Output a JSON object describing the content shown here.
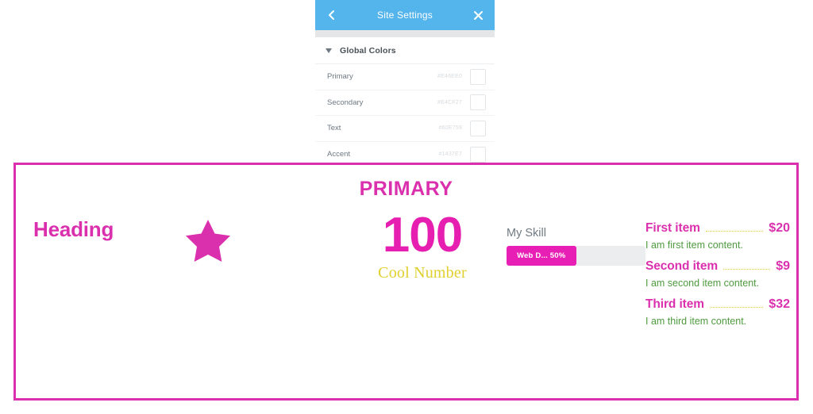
{
  "settings_panel": {
    "title": "Site Settings",
    "back_icon": "chevron-left-icon",
    "close_icon": "close-icon",
    "section": {
      "label": "Global Colors",
      "caret_icon": "caret-down-icon",
      "expanded": true
    },
    "colors": [
      {
        "name": "Primary",
        "hex": "#E46EE0",
        "swatch": "#E46EE0"
      },
      {
        "name": "Secondary",
        "hex": "#E4CF27",
        "swatch": "#E4CF27"
      },
      {
        "name": "Text",
        "hex": "#60E759",
        "swatch": "#60E759"
      },
      {
        "name": "Accent",
        "hex": "#1437E7",
        "swatch": "#1437E7"
      }
    ],
    "header_bg": "#54b4ec"
  },
  "preview": {
    "border_color": "#DB30AE",
    "section_title": "PRIMARY",
    "heading": "Heading",
    "star_icon": "star-icon",
    "star_color": "#DB30AE",
    "counter": {
      "number": "100",
      "caption": "Cool Number",
      "number_color": "#E61FB0",
      "caption_color": "#E0D02D"
    },
    "skill": {
      "label": "My Skill",
      "bar_text": "Web D... 50%",
      "percent": 50,
      "fill_color": "#E81FB4",
      "track_color": "#ebedee"
    },
    "price_list": [
      {
        "title": "First item",
        "amount": "$20",
        "description": "I am first item content."
      },
      {
        "title": "Second item",
        "amount": "$9",
        "description": "I am second item content."
      },
      {
        "title": "Third item",
        "amount": "$32",
        "description": "I am third item content."
      }
    ],
    "price_title_color": "#DB30AE",
    "price_desc_color": "#4E9A3E",
    "price_dots_color": "#E0D02D"
  }
}
